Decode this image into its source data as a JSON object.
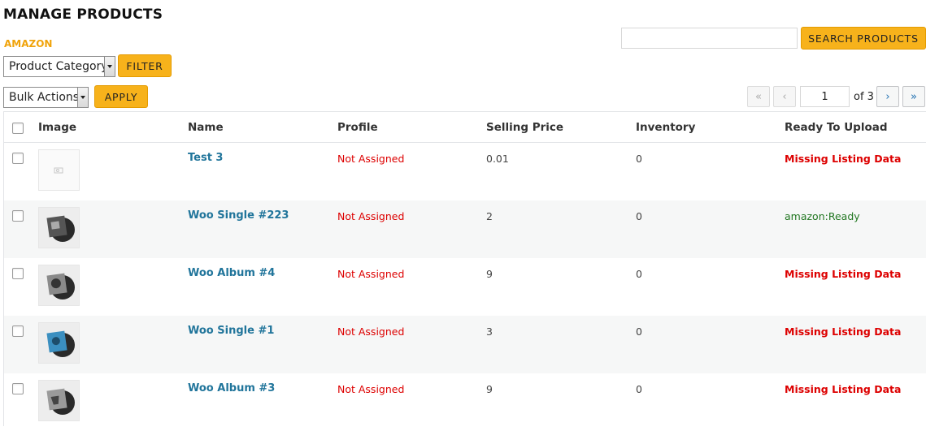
{
  "header": {
    "title": "MANAGE PRODUCTS",
    "marketplace": "AMAZON"
  },
  "filters": {
    "category_select": "Product Category",
    "filter_button": "FILTER",
    "bulk_select": "Bulk Actions",
    "apply_button": "APPLY"
  },
  "search": {
    "placeholder": "",
    "button": "SEARCH PRODUCTS"
  },
  "pagination": {
    "first": "«",
    "prev": "‹",
    "current": "1",
    "of_label": "of 3",
    "next": "›",
    "last": "»"
  },
  "table": {
    "columns": [
      "Image",
      "Name",
      "Profile",
      "Selling Price",
      "Inventory",
      "Ready To Upload"
    ],
    "rows": [
      {
        "image": "placeholder",
        "name": "Test 3",
        "profile": "Not Assigned",
        "price": "0.01",
        "inventory": "0",
        "status": "Missing Listing Data",
        "status_type": "missing"
      },
      {
        "image": "vinyl-record",
        "name": "Woo Single #223",
        "profile": "Not Assigned",
        "price": "2",
        "inventory": "0",
        "status": "amazon:Ready",
        "status_type": "ready"
      },
      {
        "image": "vinyl-record",
        "name": "Woo Album #4",
        "profile": "Not Assigned",
        "price": "9",
        "inventory": "0",
        "status": "Missing Listing Data",
        "status_type": "missing"
      },
      {
        "image": "vinyl-record-blue",
        "name": "Woo Single #1",
        "profile": "Not Assigned",
        "price": "3",
        "inventory": "0",
        "status": "Missing Listing Data",
        "status_type": "missing"
      },
      {
        "image": "vinyl-record",
        "name": "Woo Album #3",
        "profile": "Not Assigned",
        "price": "9",
        "inventory": "0",
        "status": "Missing Listing Data",
        "status_type": "missing"
      }
    ]
  },
  "colors": {
    "accent": "#f7b21b",
    "link": "#21759b",
    "error": "#dd0000",
    "ready": "#227722"
  }
}
